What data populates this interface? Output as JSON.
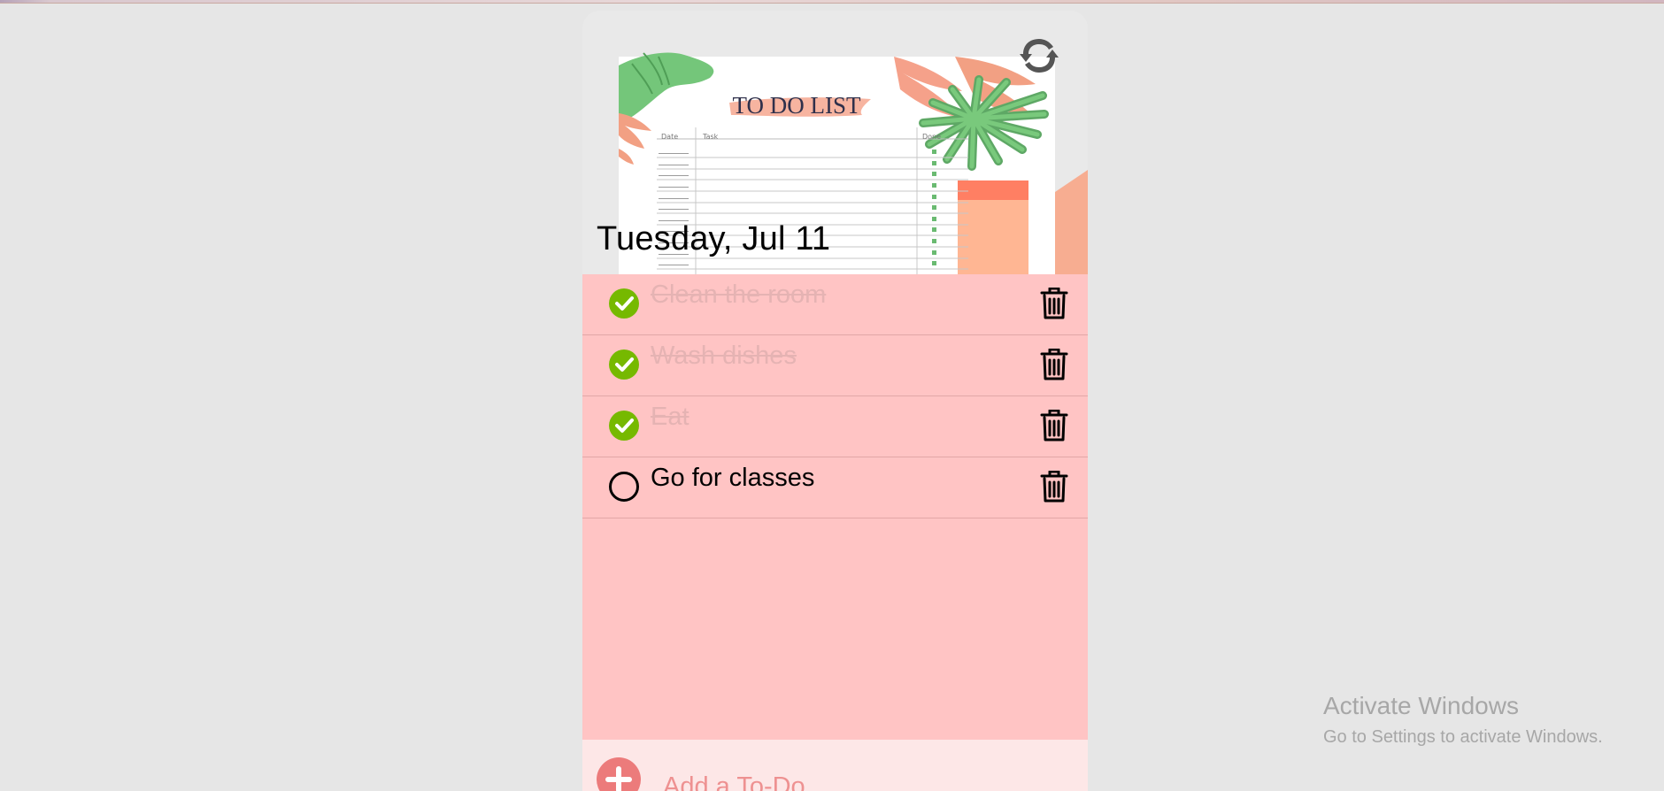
{
  "theme": {
    "accent": "#ec7b7b",
    "list_bg": "#ffc4c4",
    "done_green": "#76b900"
  },
  "header": {
    "image_label": "TO DO LIST",
    "image_columns": [
      "Date",
      "Task",
      "Done"
    ],
    "date": "Tuesday, Jul 11"
  },
  "todos": [
    {
      "text": "Clean the room",
      "done": true
    },
    {
      "text": "Wash dishes",
      "done": true
    },
    {
      "text": "Eat",
      "done": true
    },
    {
      "text": "Go for classes",
      "done": false
    }
  ],
  "icons": {
    "refresh": "refresh-icon",
    "check": "check-icon",
    "circle": "circle-icon",
    "trash": "trash-icon",
    "add": "plus-icon"
  },
  "add": {
    "placeholder": "Add a To-Do"
  },
  "watermark": {
    "title": "Activate Windows",
    "subtitle": "Go to Settings to activate Windows."
  }
}
